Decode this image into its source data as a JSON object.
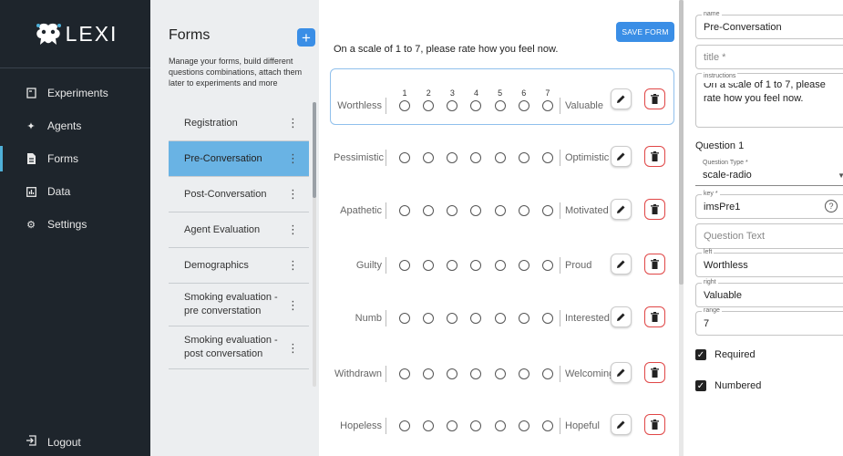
{
  "app": {
    "logo_text": "LEXI"
  },
  "nav": {
    "items": [
      {
        "label": "Experiments",
        "icon": "file-icon"
      },
      {
        "label": "Agents",
        "icon": "sparkle-icon"
      },
      {
        "label": "Forms",
        "icon": "document-icon"
      },
      {
        "label": "Data",
        "icon": "chart-icon"
      },
      {
        "label": "Settings",
        "icon": "gear-icon"
      }
    ],
    "logout": "Logout",
    "accent": "#4fb0d8"
  },
  "forms": {
    "title": "Forms",
    "add_label": "+",
    "description": "Manage your forms, build different questions combinations, attach them later to experiments and more",
    "items": [
      {
        "label": "Registration"
      },
      {
        "label": "Pre-Conversation"
      },
      {
        "label": "Post-Conversation"
      },
      {
        "label": "Agent Evaluation"
      },
      {
        "label": "Demographics"
      },
      {
        "label": "Smoking evaluation - pre converstation"
      },
      {
        "label": "Smoking evaluation - post conversation"
      }
    ],
    "kebab": "⋮"
  },
  "preview": {
    "save_label": "SAVE FORM",
    "instructions": "On a scale of 1 to 7, please rate how you feel now.",
    "numbers": [
      "1",
      "2",
      "3",
      "4",
      "5",
      "6",
      "7"
    ],
    "rows": [
      {
        "left": "Worthless",
        "right": "Valuable"
      },
      {
        "left": "Pessimistic",
        "right": "Optimistic"
      },
      {
        "left": "Apathetic",
        "right": "Motivated"
      },
      {
        "left": "Guilty",
        "right": "Proud"
      },
      {
        "left": "Numb",
        "right": "Interested"
      },
      {
        "left": "Withdrawn",
        "right": "Welcoming"
      },
      {
        "left": "Hopeless",
        "right": "Hopeful"
      }
    ]
  },
  "editor": {
    "name_label": "name",
    "name_value": "Pre-Conversation",
    "title_placeholder": "title *",
    "instructions_label": "instructions",
    "instructions_value": "On a scale of 1 to 7, please rate how you feel now.",
    "question_title": "Question 1",
    "qtype_label": "Question Type *",
    "qtype_value": "scale-radio",
    "key_label": "key *",
    "key_value": "imsPre1",
    "question_text_placeholder": "Question Text",
    "left_label": "left",
    "left_value": "Worthless",
    "right_label": "right",
    "right_value": "Valuable",
    "range_label": "range",
    "range_value": "7",
    "required_label": "Required",
    "numbered_label": "Numbered"
  }
}
